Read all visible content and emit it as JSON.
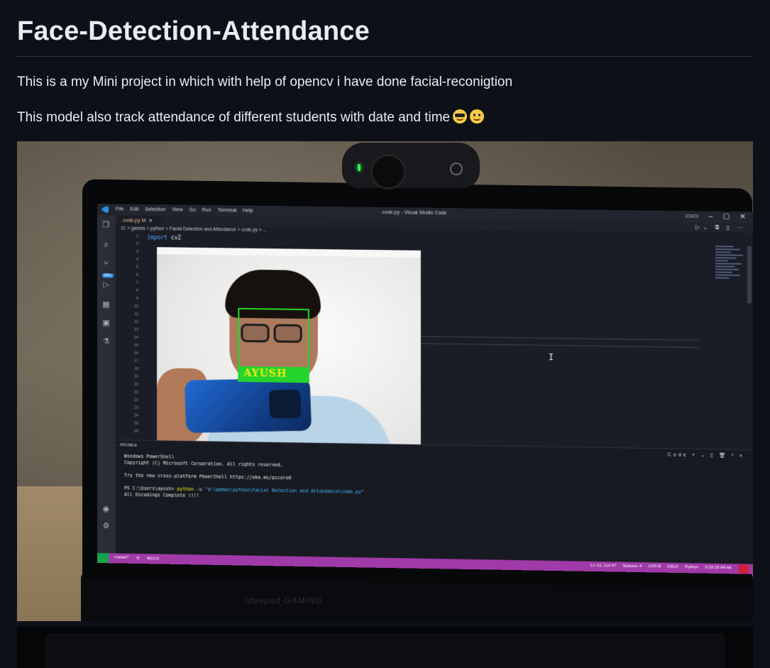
{
  "readme": {
    "title": "Face-Detection-Attendance",
    "line1": "This is a my Mini project in which with help of opencv i have done facial-reconigtion",
    "line2": "This model also track attendance of different students with date and time"
  },
  "photo": {
    "vscode": {
      "menu": [
        "File",
        "Edit",
        "Selection",
        "View",
        "Go",
        "Run",
        "Terminal",
        "Help"
      ],
      "window_title": "code.py - Visual Studio Code",
      "tab_label": "code.py M",
      "breadcrumb": "D: > games > python > Facial Detection and Attendance > code.py > ...",
      "code_line1_kw": "import",
      "code_line1_id": "cv2",
      "line_numbers": [
        "1",
        "2",
        "3",
        "4",
        "5",
        "6",
        "7",
        "8",
        "9",
        "10",
        "11",
        "12",
        "13",
        "14",
        "15",
        "16",
        "17",
        "18",
        "19",
        "20",
        "21",
        "22",
        "23",
        "24",
        "25",
        "26"
      ],
      "panel_label": "PROBLE",
      "panel_tools": "Code + ⌄ ▯ 🗑 ^ ×",
      "terminal": {
        "l1": "Windows PowerShell",
        "l2": "Copyright (C) Microsoft Corporation. All rights reserved.",
        "l3": "Try the new cross-platform PowerShell https://aka.ms/pscore6",
        "prompt": "PS C:\\Users\\ayush> ",
        "cmd": "python",
        "flag": " -u ",
        "path": "\"d:\\games\\python\\Facial Detection and Attendance\\code.py\"",
        "l5": "All Encodings Complete !!!!"
      },
      "status_left": [
        "master*",
        "⟲",
        "⊗0⚠0"
      ],
      "status_right": [
        "Ln 12, Col 47",
        "Spaces: 4",
        "UTF-8",
        "CRLF",
        "Python",
        "3.10.10 64-bit"
      ]
    },
    "detection_label": "AYUSH",
    "base_brand": "ideapad GAMING"
  }
}
